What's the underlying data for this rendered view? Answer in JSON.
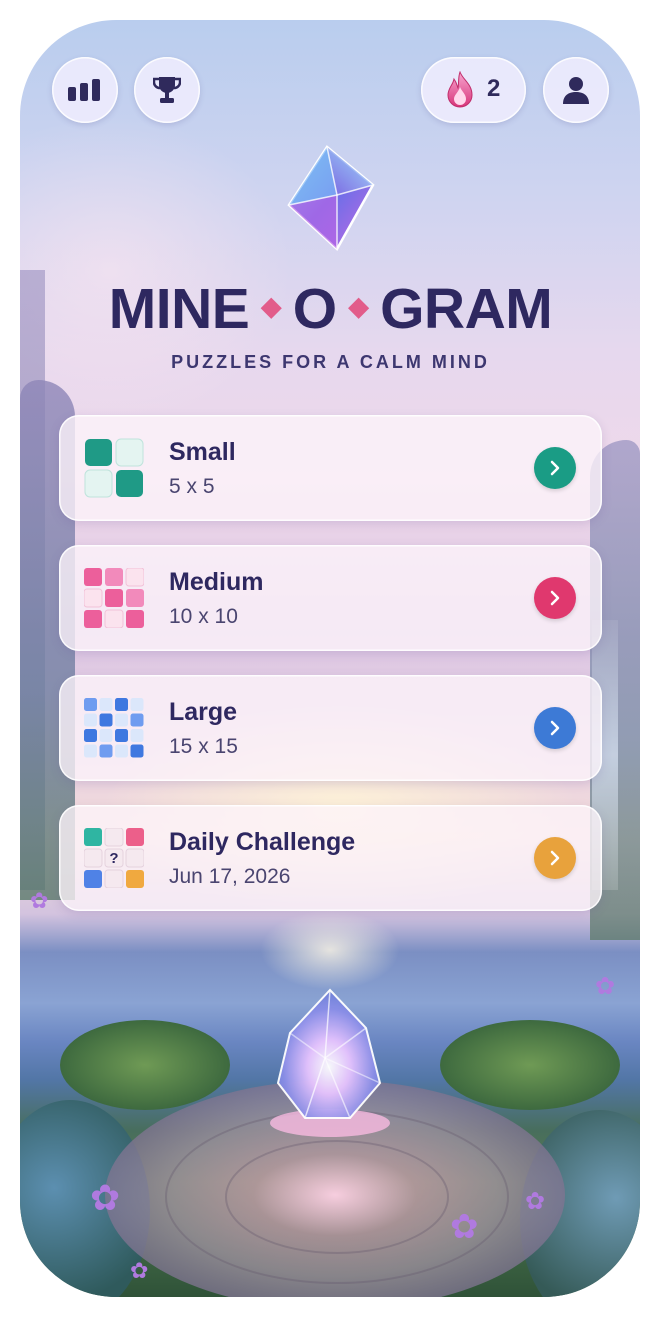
{
  "header": {
    "stats_icon": "bar-chart-icon",
    "trophy_icon": "trophy-icon",
    "streak_icon": "flame-icon",
    "streak_count": "2",
    "profile_icon": "user-icon"
  },
  "logo": {
    "title_left": "MINE",
    "title_middle": "O",
    "title_right": "GRAM",
    "subtitle": "PUZZLES FOR A CALM MIND"
  },
  "modes": [
    {
      "name": "Small",
      "size": "5 x 5",
      "color": "#1a9c85"
    },
    {
      "name": "Medium",
      "size": "10 x 10",
      "color": "#e0386e"
    },
    {
      "name": "Large",
      "size": "15 x 15",
      "color": "#3d7ad6"
    },
    {
      "name": "Daily Challenge",
      "size": "Jun 17, 2026",
      "color": "#e8a23c",
      "mystery_mark": "?"
    }
  ]
}
